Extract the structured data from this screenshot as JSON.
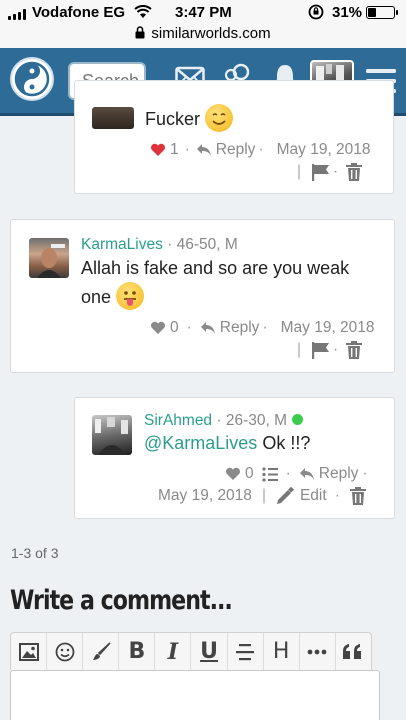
{
  "status_bar": {
    "carrier": "Vodafone EG",
    "time": "3:47 PM",
    "battery": "31%",
    "battery_level": 0.31,
    "url": "similarworlds.com"
  },
  "header": {
    "search_placeholder": "Search",
    "icons": [
      "logo-icon",
      "mail-icon",
      "friends-icon",
      "bell-icon",
      "profile-avatar",
      "menu-icon"
    ]
  },
  "comments": [
    {
      "text": "Fucker",
      "likes": "1",
      "reply_label": "Reply",
      "date": "May 19, 2018",
      "liked": true
    },
    {
      "author": "KarmaLives",
      "demographics": "46-50, M",
      "text": "Allah is fake and so are you weak one",
      "likes": "0",
      "reply_label": "Reply",
      "date": "May 19, 2018"
    },
    {
      "author": "SirAhmed",
      "demographics": "26-30, M",
      "mention": "@KarmaLives",
      "text": "Ok !!?",
      "likes": "0",
      "reply_label": "Reply",
      "date": "May 19, 2018",
      "edit_label": "Edit",
      "online": true
    }
  ],
  "pagination": "1-3 of 3",
  "write_heading": "Write a comment...",
  "editor_toolbar": [
    "image",
    "emoji",
    "brush",
    "B",
    "I",
    "U",
    "strikethrough",
    "H",
    "more",
    "quote"
  ],
  "colors": {
    "header": "#2e6b96",
    "name_link": "#2a9d8f",
    "like_active": "#e0323b",
    "online": "#3ccc4c"
  }
}
